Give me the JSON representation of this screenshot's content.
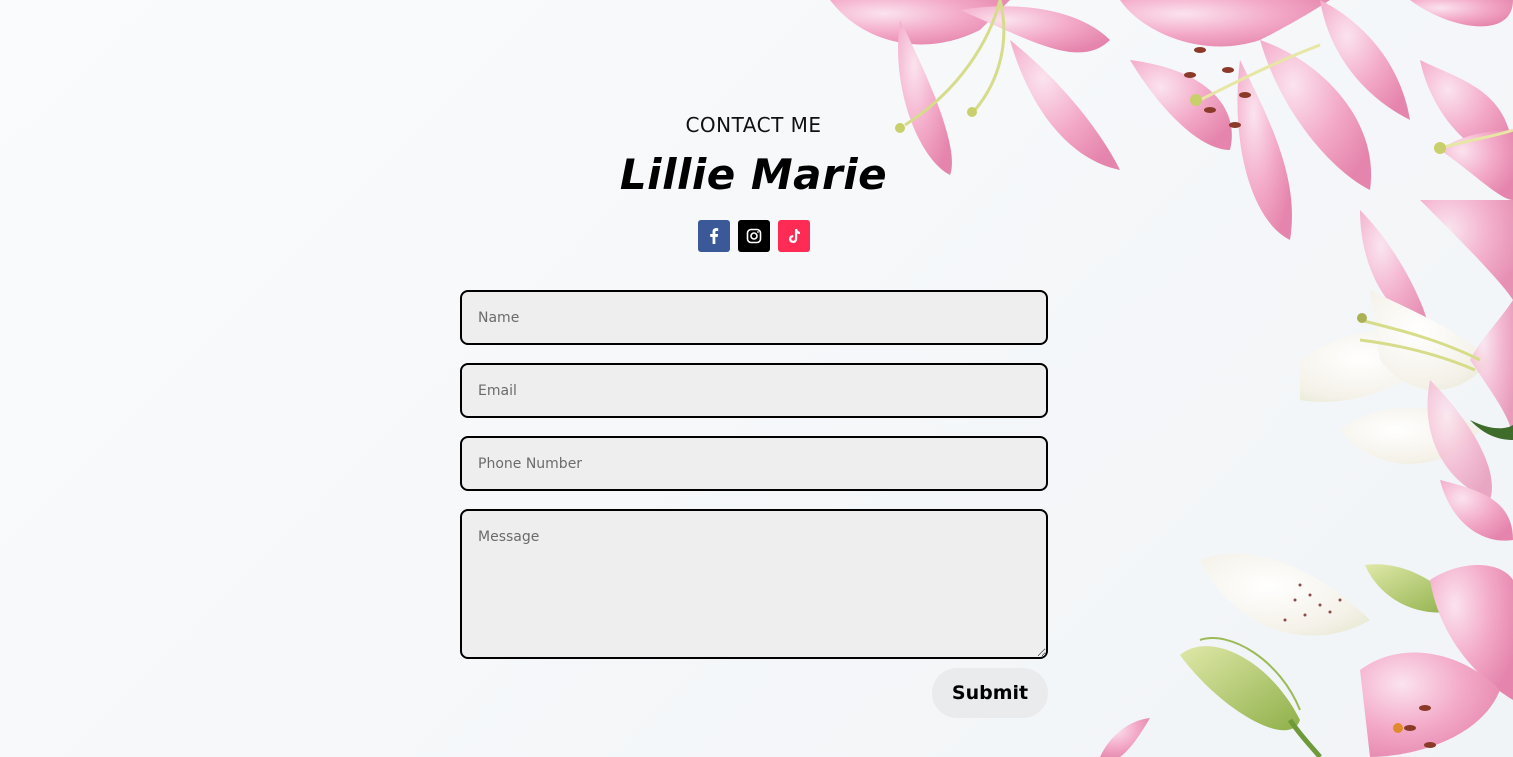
{
  "header": {
    "eyebrow": "CONTACT ME",
    "title": "Lillie Marie"
  },
  "socials": [
    {
      "name": "facebook",
      "icon": "facebook-icon",
      "color": "#3b5998"
    },
    {
      "name": "instagram",
      "icon": "instagram-icon",
      "color": "#000000"
    },
    {
      "name": "tiktok",
      "icon": "tiktok-icon",
      "color": "#fe2c55"
    }
  ],
  "form": {
    "name_placeholder": "Name",
    "email_placeholder": "Email",
    "phone_placeholder": "Phone Number",
    "message_placeholder": "Message",
    "submit_label": "Submit"
  },
  "colors": {
    "field_bg": "#eeeeee",
    "field_border": "#000000",
    "button_bg": "#e9ebed",
    "petal_pink": "#f2a3c3",
    "petal_white": "#f6f1ea"
  }
}
